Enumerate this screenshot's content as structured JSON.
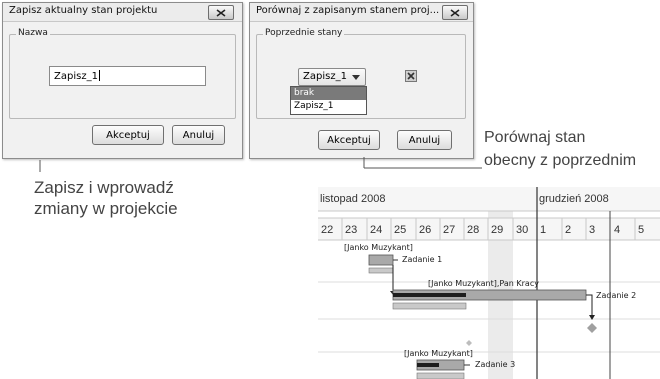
{
  "dialog1": {
    "title": "Zapisz aktualny stan projektu",
    "group_label": "Nazwa",
    "name_value": "Zapisz_1",
    "accept_label": "Akceptuj",
    "cancel_label": "Anuluj"
  },
  "dialog2": {
    "title": "Porównaj z zapisanym stanem proj...",
    "group_label": "Poprzednie stany",
    "selected_value": "Zapisz_1",
    "options": [
      "brak",
      "Zapisz_1"
    ],
    "accept_label": "Akceptuj",
    "cancel_label": "Anuluj"
  },
  "captions": {
    "save_line1": "Zapisz i wprowadź",
    "save_line2": "zmiany w projekcie",
    "compare_line1": "Porównaj stan",
    "compare_line2": "obecny z poprzednim"
  },
  "gantt": {
    "months": [
      "listopad 2008",
      "grudzień 2008"
    ],
    "days": [
      "22",
      "23",
      "24",
      "25",
      "26",
      "27",
      "28",
      "29",
      "30",
      "1",
      "2",
      "3",
      "4",
      "5"
    ],
    "tasks": [
      {
        "resource": "[Janko Muzykant]",
        "name": "Zadanie 1"
      },
      {
        "resource": "[Janko Muzykant],Pan Kracy",
        "name": "Zadanie 2"
      },
      {
        "resource": "[Janko Muzykant]",
        "name": "Zadanie 3"
      }
    ]
  }
}
